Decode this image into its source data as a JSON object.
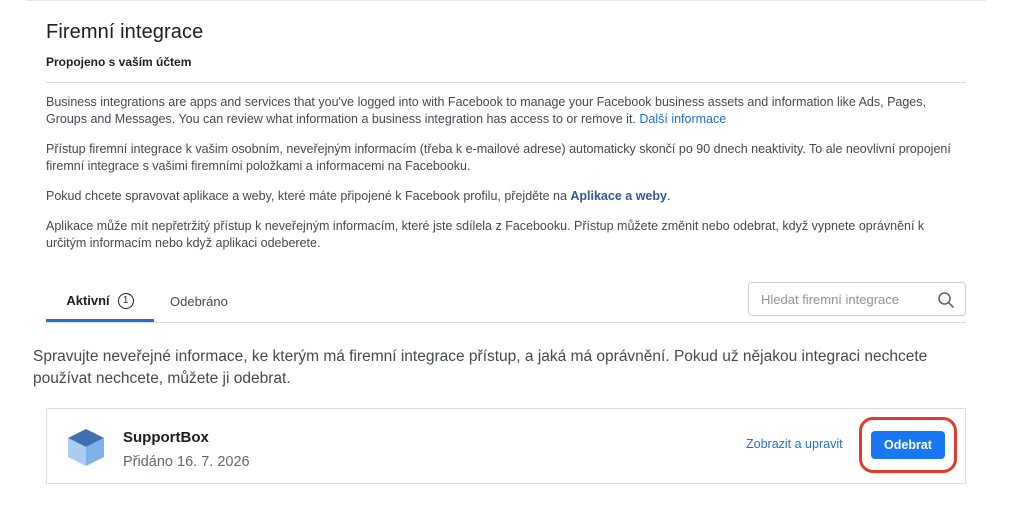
{
  "header": {
    "title": "Firemní integrace",
    "subtitle": "Propojeno s vaším účtem"
  },
  "info": {
    "para1_text": "Business integrations are apps and services that you've logged into with Facebook to manage your Facebook business assets and information like Ads, Pages, Groups and Messages. You can review what information a business integration has access to or remove it. ",
    "para1_link": "Další informace",
    "para2_text": "Přístup firemní integrace k vašim osobním, neveřejným informacím (třeba k e-mailové adrese) automaticky skončí po 90 dnech neaktivity. To ale neovlivní propojení firemní integrace s vašimi firemními položkami a informacemi na Facebooku.",
    "para3_before": "Pokud chcete spravovat aplikace a weby, které máte připojené k Facebook profilu, přejděte na ",
    "para3_link": "Aplikace a weby",
    "para3_after": ".",
    "para4_text": "Aplikace může mít nepřetržitý přístup k neveřejným informacím, které jste sdílela z Facebooku. Přístup můžete změnit nebo odebrat, když vypnete oprávnění k určitým informacím nebo když aplikaci odeberete."
  },
  "tabs": [
    {
      "label": "Aktivní",
      "count": "1"
    },
    {
      "label": "Odebráno"
    }
  ],
  "search": {
    "placeholder": "Hledat firemní integrace",
    "icon": "search-icon"
  },
  "manage_text": "Spravujte neveřejné informace, ke kterým má firemní integrace přístup, a jaká má oprávnění. Pokud už nějakou integraci nechcete používat nechcete, můžete ji odebrat.",
  "integrations": [
    {
      "name": "SupportBox",
      "added": "Přidáno 16. 7. 2026",
      "icon": "cube-icon",
      "edit_label": "Zobrazit a upravit",
      "remove_label": "Odebrat"
    }
  ],
  "colors": {
    "accent": "#1877f2",
    "link": "#216fdb",
    "highlight": "#e43a2a"
  }
}
